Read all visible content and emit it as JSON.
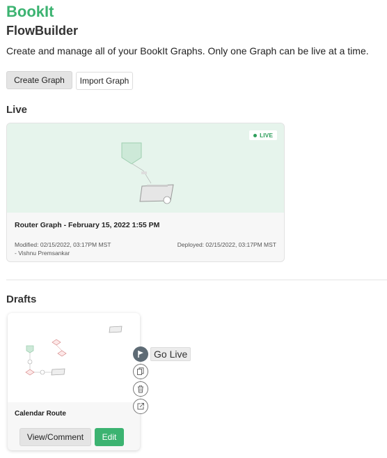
{
  "brand": "BookIt",
  "page": {
    "title": "FlowBuilder",
    "subtitle": "Create and manage all of your BookIt Graphs. Only one Graph can be live at a time."
  },
  "toolbar": {
    "create_label": "Create Graph",
    "import_label": "Import Graph"
  },
  "live": {
    "section_title": "Live",
    "badge": "LIVE",
    "graph_name": "Router Graph - February 15, 2022 1:55 PM",
    "modified": "Modified: 02/15/2022, 03:17PM MST",
    "author": "- Vishnu Premsankar",
    "deployed": "Deployed: 02/15/2022, 03:17PM MST"
  },
  "drafts": {
    "section_title": "Drafts",
    "items": [
      {
        "name": "Calendar Route",
        "view_label": "View/Comment",
        "edit_label": "Edit"
      }
    ]
  },
  "actions": {
    "go_live_tooltip": "Go Live",
    "icons": [
      "go-live-icon",
      "copy-icon",
      "delete-icon",
      "export-icon"
    ]
  },
  "colors": {
    "brand": "#3cb371",
    "live_preview_bg": "#e6f4ec",
    "edit_button": "#3cb371"
  }
}
